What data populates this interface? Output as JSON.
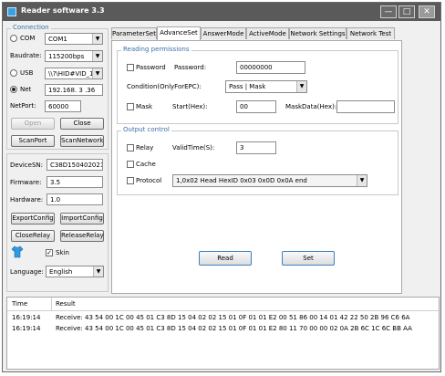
{
  "window": {
    "title": "Reader software 3.3",
    "minimize": "—",
    "maximize": "□",
    "close": "✕"
  },
  "connection": {
    "legend": "Connection",
    "com_label": "COM",
    "com_value": "COM1",
    "baudrate_label": "Baudrate:",
    "baudrate_value": "115200bps",
    "usb_label": "USB",
    "usb_value": "\\\\?\\HID#VID_1A",
    "net_label": "Net",
    "net_value": "192.168. 3 .36",
    "netport_label": "NetPort:",
    "netport_value": "60000",
    "open_label": "Open",
    "close_label": "Close",
    "scanport_label": "ScanPort",
    "scannetwork_label": "ScanNetwork"
  },
  "device": {
    "sn_label": "DeviceSN:",
    "sn_value": "C38D1504020215",
    "firmware_label": "Firmware:",
    "firmware_value": "3.5",
    "hardware_label": "Hardware:",
    "hardware_value": "1.0",
    "exportconfig_label": "ExportConfig",
    "importconfig_label": "ImportConfig",
    "closerelay_label": "CloseRelay",
    "releaserelay_label": "ReleaseRelay",
    "skin_label": "Skin",
    "language_label": "Language:",
    "language_value": "English"
  },
  "tabs": [
    "ParameterSet",
    "AdvanceSet",
    "AnswerMode",
    "ActiveMode",
    "Network Settings",
    "Network Test"
  ],
  "reading": {
    "legend": "Reading permissions",
    "password_chk": "Password",
    "password_label": "Password:",
    "password_value": "00000000",
    "condition_label": "Condition(OnlyForEPC):",
    "condition_value": "Pass | Mask",
    "mask_chk": "Mask",
    "start_label": "Start(Hex):",
    "start_value": "00",
    "maskdata_label": "MaskData(Hex):",
    "maskdata_value": ""
  },
  "output": {
    "legend": "Output control",
    "relay_chk": "Relay",
    "validtime_label": "ValidTime(S):",
    "validtime_value": "3",
    "cache_chk": "Cache",
    "protocol_chk": "Protocol",
    "protocol_value": "1,0x02 Head HexID 0x03 0x0D 0x0A end"
  },
  "actions": {
    "read_label": "Read",
    "set_label": "Set"
  },
  "log": {
    "col_time": "Time",
    "col_result": "Result",
    "rows": [
      {
        "time": "16:19:14",
        "result": "Receive: 43 54 00 1C 00 45 01 C3 8D 15 04 02 02 15 01 0F 01 01 E2 00 51 86 00 14 01 42 22 50 2B 96 C6 6A"
      },
      {
        "time": "16:19:14",
        "result": "Receive: 43 54 00 1C 00 45 01 C3 8D 15 04 02 02 15 01 0F 01 01 E2 80 11 70 00 00 02 0A 2B 6C 1C 6C BB AA"
      }
    ]
  }
}
